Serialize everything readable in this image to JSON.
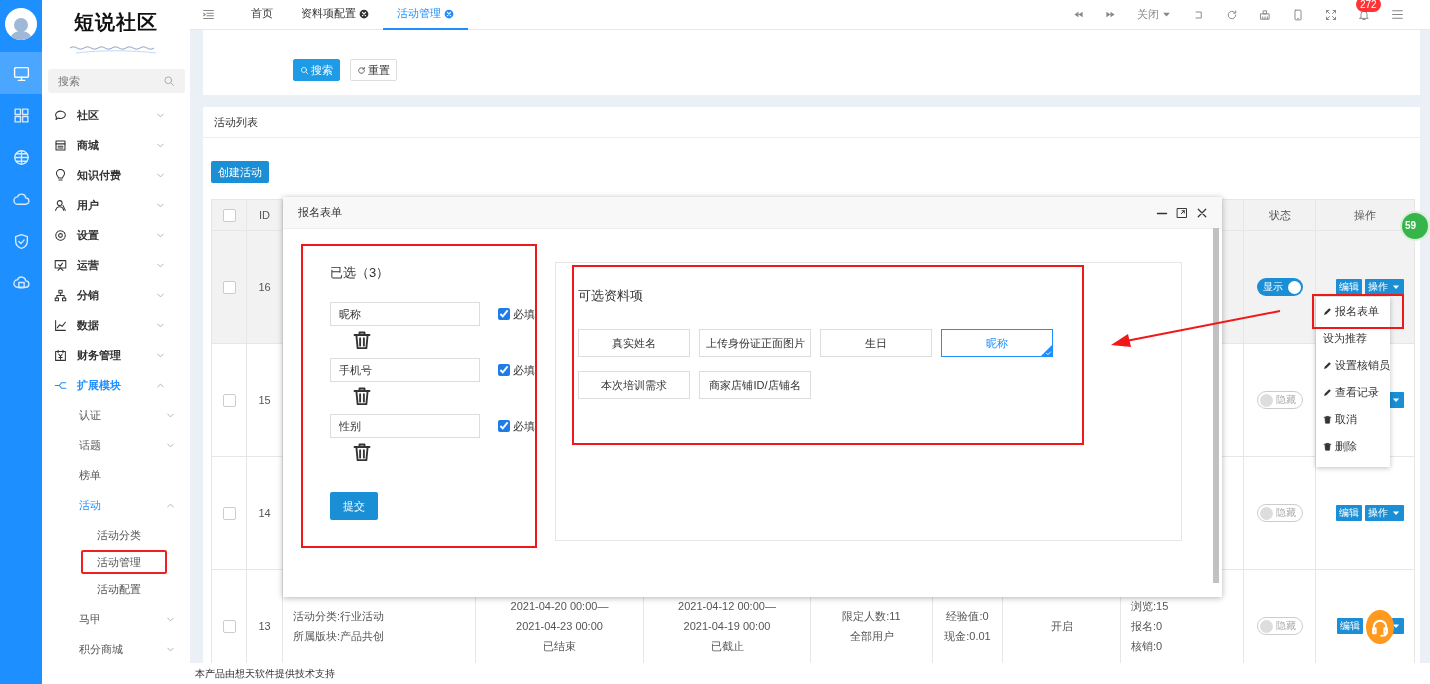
{
  "rail": {
    "items": [
      {
        "kind": "monitor",
        "selected": true
      },
      {
        "kind": "grid",
        "selected": false
      },
      {
        "kind": "globe",
        "selected": false
      },
      {
        "kind": "cloud",
        "selected": false
      },
      {
        "kind": "shield",
        "selected": false
      },
      {
        "kind": "cloud-server",
        "selected": false
      }
    ]
  },
  "sidebar": {
    "logo": "短说社区",
    "search": {
      "placeholder": "搜索"
    },
    "items": [
      {
        "label": "社区",
        "expanded": false,
        "selected": false
      },
      {
        "label": "商城",
        "expanded": false,
        "selected": false
      },
      {
        "label": "知识付费",
        "expanded": false,
        "selected": false
      },
      {
        "label": "用户",
        "expanded": false,
        "selected": false
      },
      {
        "label": "设置",
        "expanded": false,
        "selected": false
      },
      {
        "label": "运营",
        "expanded": false,
        "selected": false
      },
      {
        "label": "分销",
        "expanded": false,
        "selected": false
      },
      {
        "label": "数据",
        "expanded": false,
        "selected": false
      },
      {
        "label": "财务管理",
        "expanded": false,
        "selected": false
      },
      {
        "label": "扩展模块",
        "expanded": true,
        "selected": true,
        "children": [
          {
            "label": "认证",
            "expanded": false,
            "selected": false
          },
          {
            "label": "话题",
            "expanded": false,
            "selected": false
          },
          {
            "label": "榜单",
            "selected": false
          },
          {
            "label": "活动",
            "expanded": true,
            "selected": true,
            "children": [
              {
                "label": "活动分类",
                "selected": false,
                "highlighted": false
              },
              {
                "label": "活动管理",
                "selected": false,
                "highlighted": true
              },
              {
                "label": "活动配置",
                "selected": false,
                "highlighted": false
              }
            ]
          },
          {
            "label": "马甲",
            "expanded": false,
            "selected": false
          },
          {
            "label": "积分商城",
            "expanded": false,
            "selected": false
          }
        ]
      }
    ]
  },
  "topbar": {
    "tabs": [
      {
        "label": "首页",
        "closable": false,
        "selected": false
      },
      {
        "label": "资料项配置",
        "closable": true,
        "selected": false
      },
      {
        "label": "活动管理",
        "closable": true,
        "selected": true
      }
    ],
    "close_menu": "关闭",
    "notifications": "272"
  },
  "filter": {
    "buttons": [
      {
        "label": "搜索",
        "kind": "primary"
      },
      {
        "label": "重置",
        "kind": "default"
      }
    ]
  },
  "list": {
    "title": "活动列表",
    "create_button": "创建活动",
    "select_all": {
      "checked": false
    },
    "columns": {
      "id": "ID",
      "status": "状态",
      "actions": "操作"
    },
    "rows": [
      {
        "id": "16",
        "selected": true,
        "checked": false,
        "status": {
          "label": "显示",
          "on": true
        },
        "actions": [
          "编辑",
          "操作"
        ]
      },
      {
        "id": "15",
        "selected": false,
        "checked": false,
        "status": {
          "label": "隐藏",
          "on": false
        }
      },
      {
        "id": "14",
        "selected": false,
        "checked": false,
        "status": {
          "label": "隐藏",
          "on": false
        },
        "actions": [
          "编辑",
          "操作"
        ]
      },
      {
        "id": "13",
        "selected": false,
        "checked": false,
        "status": {
          "label": "隐藏",
          "on": false
        },
        "actions": [
          "编辑"
        ],
        "details": {
          "info": [
            "活动分类:行业活动",
            "所属版块:产品共创"
          ],
          "time_range": [
            "2021-04-20 00:00—",
            "2021-04-23 00:00",
            "已结束"
          ],
          "signup_range": [
            "2021-04-12 00:00—",
            "2021-04-19 00:00",
            "已截止"
          ],
          "limit": [
            "限定人数:11",
            "全部用户"
          ],
          "reward": [
            "经验值:0",
            "现金:0.01"
          ],
          "switch": "开启",
          "stats": [
            "浏览:15",
            "报名:0",
            "核销:0"
          ]
        }
      }
    ]
  },
  "modal": {
    "title": "报名表单",
    "selected_panel": {
      "title": "已选（3）",
      "highlighted": true,
      "submit": "提交",
      "fields": [
        {
          "value": "昵称",
          "required": true,
          "required_label": "必填"
        },
        {
          "value": "手机号",
          "required": true,
          "required_label": "必填"
        },
        {
          "value": "性别",
          "required": true,
          "required_label": "必填"
        }
      ]
    },
    "available_panel": {
      "title": "可选资料项",
      "highlighted": true,
      "fields": [
        {
          "label": "真实姓名",
          "selected": false
        },
        {
          "label": "上传身份证正面图片",
          "selected": false
        },
        {
          "label": "生日",
          "selected": false
        },
        {
          "label": "昵称",
          "selected": true
        },
        {
          "label": "本次培训需求",
          "selected": false
        },
        {
          "label": "商家店铺ID/店铺名",
          "selected": false
        }
      ]
    }
  },
  "dropdown": {
    "items": [
      {
        "label": "报名表单",
        "kind": "pencil",
        "highlighted": true
      },
      {
        "label": "设为推荐",
        "kind": "plain",
        "highlighted": false
      },
      {
        "label": "设置核销员",
        "kind": "pencil",
        "highlighted": false
      },
      {
        "label": "查看记录",
        "kind": "pencil",
        "highlighted": false
      },
      {
        "label": "取消",
        "kind": "trash",
        "highlighted": false
      },
      {
        "label": "删除",
        "kind": "trash",
        "highlighted": false
      }
    ]
  },
  "annotation_arrow": true,
  "float_badge": "59",
  "footer": "本产品由想天软件提供技术支持"
}
